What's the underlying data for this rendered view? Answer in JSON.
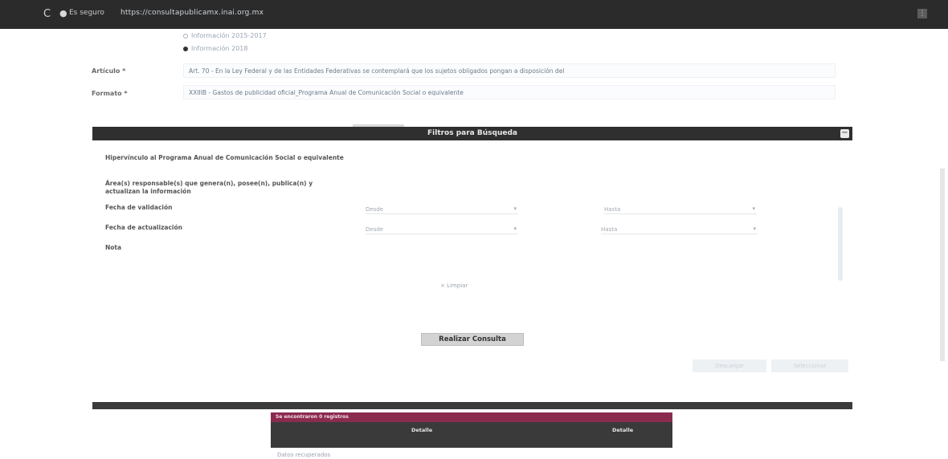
{
  "browser": {
    "reload_glyph": "C",
    "lock_glyph": "●",
    "security_label": "Es seguro",
    "url": "https://consultapublicamx.inai.org.mx",
    "menu_glyph": "⋮"
  },
  "form": {
    "options": [
      {
        "label": "Información 2015-2017",
        "checked": false
      },
      {
        "label": "Información 2018",
        "checked": true
      }
    ],
    "articulo_label": "Artículo *",
    "articulo_value": "Art. 70 - En la Ley Federal y de las Entidades Federativas se contemplará que los sujetos obligados pongan a disposición del",
    "formato_label": "Formato *",
    "formato_value": "XXIIIB - Gastos de publicidad oficial_Programa Anual de Comunicación Social o equivalente"
  },
  "filters": {
    "title": "Filtros para Búsqueda",
    "collapse_glyph": "−",
    "labels": {
      "programa": "Hipervínculo al Programa Anual de Comunicación Social o equivalente",
      "areas": "Área(s) responsable(s) que genera(n), posee(n), publica(n) y actualizan la información",
      "validacion": "Fecha de validación",
      "actualizacion": "Fecha de actualización",
      "nota": "Nota"
    },
    "desde_placeholder": "Desde",
    "hasta_placeholder": "Hasta",
    "chevron_glyph": "▾",
    "limpiar": "× Limpiar"
  },
  "actions": {
    "consulta": "Realizar Consulta",
    "descargar": "Descargar",
    "seleccion": "Seleccionar"
  },
  "results": {
    "header": "Se encontraron 0 registros",
    "col1": "Detalle",
    "col2": "Detalle",
    "footer": "Datos recuperados"
  }
}
